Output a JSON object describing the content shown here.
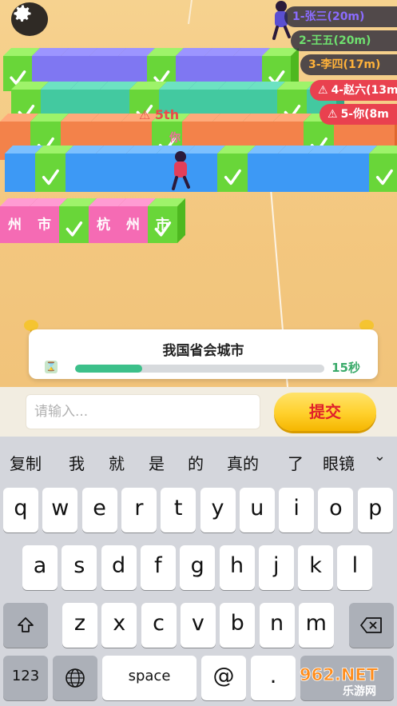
{
  "leaderboard": [
    {
      "label": "1-张三(20m)"
    },
    {
      "label": "2-王五(20m)"
    },
    {
      "label": "3-李四(17m)"
    },
    {
      "label": "4-赵六(13m",
      "warn": "⚠"
    },
    {
      "label": "5-你(8m",
      "warn": "⚠"
    }
  ],
  "player": {
    "rank_label": "5th",
    "name": "你",
    "warn": "⚠"
  },
  "track_text": {
    "row5": [
      "州",
      "市",
      "杭",
      "州",
      "市"
    ]
  },
  "question": {
    "text": "我国省会城市",
    "time_left": "15秒",
    "timer_icon": "⌛",
    "progress": 0.27
  },
  "answer": {
    "placeholder": "请输入...",
    "value": "",
    "submit_label": "提交"
  },
  "keyboard": {
    "suggestions": [
      "复制",
      "我",
      "就",
      "是",
      "的",
      "真的",
      "了",
      "眼镜"
    ],
    "row1": [
      "q",
      "w",
      "e",
      "r",
      "t",
      "y",
      "u",
      "i",
      "o",
      "p"
    ],
    "row2": [
      "a",
      "s",
      "d",
      "f",
      "g",
      "h",
      "j",
      "k",
      "l"
    ],
    "row3": [
      "z",
      "x",
      "c",
      "v",
      "b",
      "n",
      "m"
    ],
    "numbers_label": "123",
    "space_label": "space",
    "at_label": "@",
    "dot_label": "."
  },
  "watermark": {
    "text": "962.NET",
    "sub": "乐游网"
  },
  "icons": {
    "settings": "gear-icon",
    "shift": "shift-icon",
    "backspace": "backspace-icon",
    "globe": "globe-icon"
  }
}
